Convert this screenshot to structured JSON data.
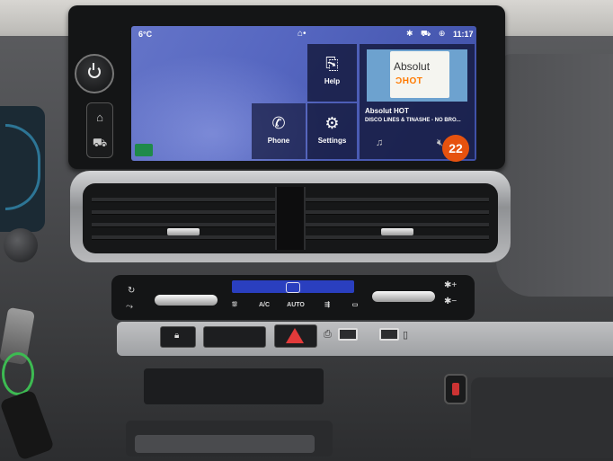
{
  "infotainment": {
    "status_bar": {
      "temperature": "6°C",
      "home_indicator": "⌂•",
      "status_icons": "✱ ⛟ ⊕",
      "clock": "11:17"
    },
    "tiles": {
      "help": {
        "label": "Help",
        "icon": "book-icon"
      },
      "phone": {
        "label": "Phone",
        "icon": "phone-icon"
      },
      "settings": {
        "label": "Settings",
        "icon": "gear-icon"
      }
    },
    "media": {
      "art_line1": "Absolut",
      "art_line2": "ƆHOT",
      "station": "Absolut HOT",
      "track": "DISCO LINES & TINASHE - NO BRO...",
      "controls_icon": "music-icon",
      "mute_icon": "mute-icon"
    },
    "badge_number": "22"
  },
  "climate": {
    "buttons": [
      "A/C",
      "AUTO"
    ],
    "display_color": "#2a3fbf",
    "fan_plus": "✱+",
    "fan_minus": "✱−"
  },
  "colors": {
    "screen_accent": "#5566c0",
    "badge": "#e6520f",
    "hazard": "#e23a3a",
    "keyring": "#3dbb52"
  }
}
